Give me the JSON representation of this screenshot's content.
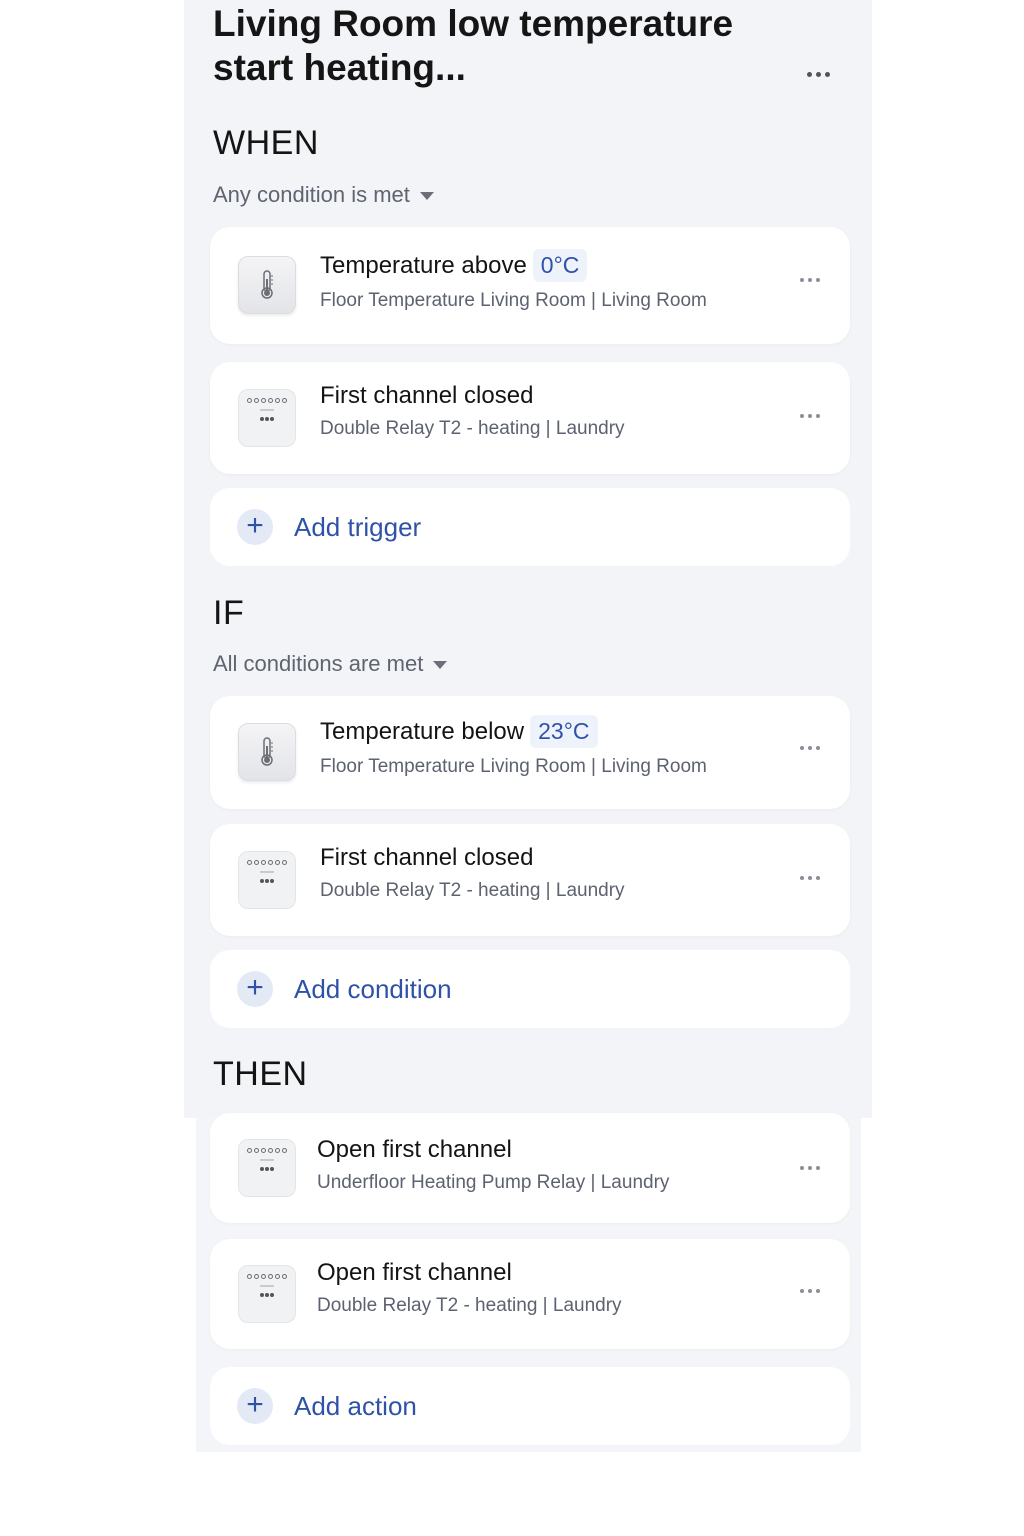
{
  "automation": {
    "title": "Living Room low temperature start heating...",
    "more_icon": "more-horizontal-icon"
  },
  "when": {
    "label": "WHEN",
    "match": "Any condition is met",
    "triggers": [
      {
        "icon": "thermometer-icon",
        "title": "Temperature above",
        "value": "0°C",
        "subtitle": "Floor Temperature Living Room | Living Room"
      },
      {
        "icon": "relay-icon",
        "title": "First channel closed",
        "subtitle": "Double Relay T2 - heating | Laundry"
      }
    ],
    "add_label": "Add trigger"
  },
  "if": {
    "label": "IF",
    "match": "All conditions are met",
    "conditions": [
      {
        "icon": "thermometer-icon",
        "title": "Temperature below",
        "value": "23°C",
        "subtitle": "Floor Temperature Living Room | Living Room"
      },
      {
        "icon": "relay-icon",
        "title": "First channel closed",
        "subtitle": "Double Relay T2 - heating | Laundry"
      }
    ],
    "add_label": "Add condition"
  },
  "then": {
    "label": "THEN",
    "actions": [
      {
        "icon": "relay-icon",
        "title": "Open first channel",
        "subtitle": "Underfloor Heating Pump Relay | Laundry"
      },
      {
        "icon": "relay-icon",
        "title": "Open first channel",
        "subtitle": "Double Relay T2 - heating | Laundry"
      }
    ],
    "add_label": "Add action"
  },
  "colors": {
    "accent": "#2f52a8",
    "panel_bg": "#f3f4f7",
    "card_bg": "#ffffff",
    "chip_bg": "#eef2fa"
  }
}
